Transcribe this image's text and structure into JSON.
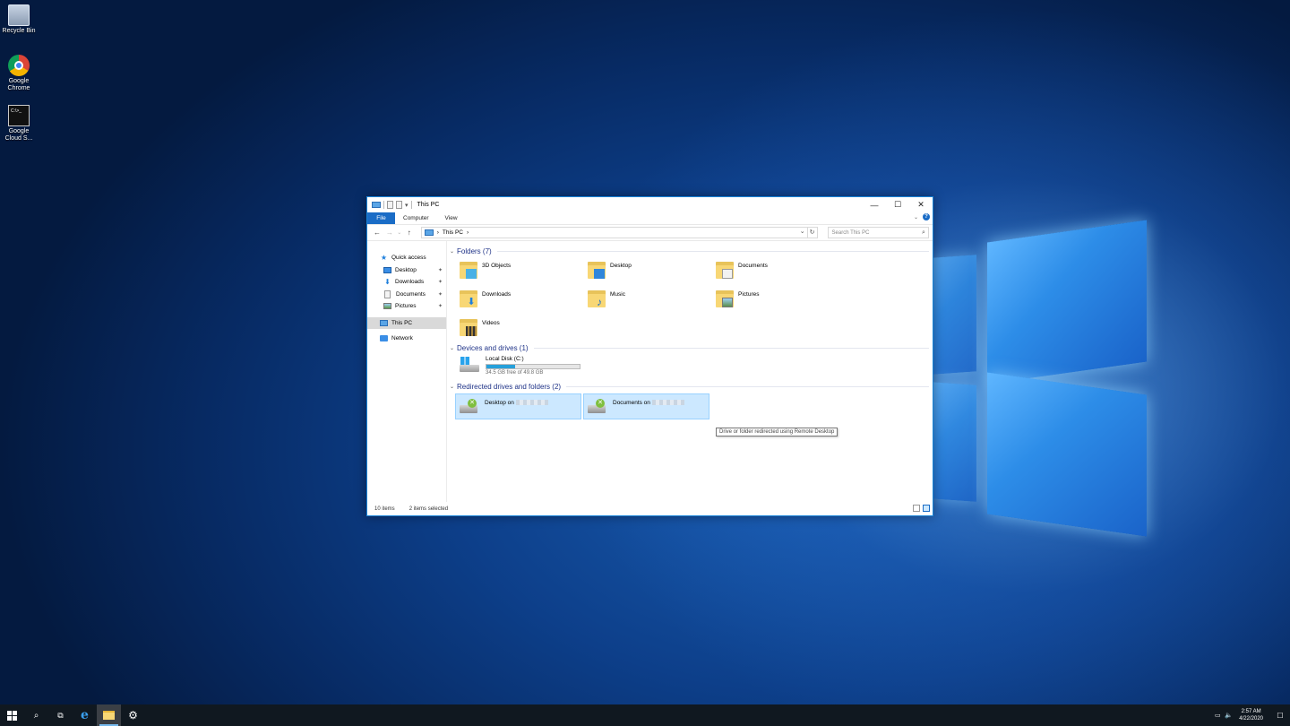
{
  "desktop": {
    "icons": [
      {
        "label": "Recycle Bin"
      },
      {
        "label": "Google Chrome"
      },
      {
        "label": "Google Cloud S...",
        "glyph": "C:\\>_"
      }
    ]
  },
  "window": {
    "title": "This PC",
    "accent": "#1a6cc6",
    "ribbon": {
      "tabs": [
        "File",
        "Computer",
        "View"
      ]
    },
    "address": {
      "segment": "This PC",
      "separator": "›"
    },
    "search_placeholder": "Search This PC",
    "nav": {
      "quick_access": "Quick access",
      "quick_items": [
        {
          "label": "Desktop",
          "icon": "desktop-icon"
        },
        {
          "label": "Downloads",
          "icon": "download-icon"
        },
        {
          "label": "Documents",
          "icon": "document-icon"
        },
        {
          "label": "Pictures",
          "icon": "picture-icon"
        }
      ],
      "this_pc": "This PC",
      "network": "Network"
    },
    "groups": {
      "folders": {
        "title": "Folders (7)",
        "items": [
          "3D Objects",
          "Desktop",
          "Documents",
          "Downloads",
          "Music",
          "Pictures",
          "Videos"
        ]
      },
      "devices": {
        "title": "Devices and drives (1)",
        "drive": {
          "name": "Local Disk (C:)",
          "free_text": "34.5 GB free of 49.8 GB",
          "used_fraction": 0.31
        }
      },
      "redirected": {
        "title": "Redirected drives and folders (2)",
        "items": [
          "Desktop on",
          "Documents on"
        ]
      }
    },
    "tooltip": "Drive or folder redirected using Remote Desktop",
    "status": {
      "count": "10 items",
      "selected": "2 items selected"
    }
  },
  "taskbar": {
    "time": "2:57 AM",
    "date": "4/22/2020"
  }
}
